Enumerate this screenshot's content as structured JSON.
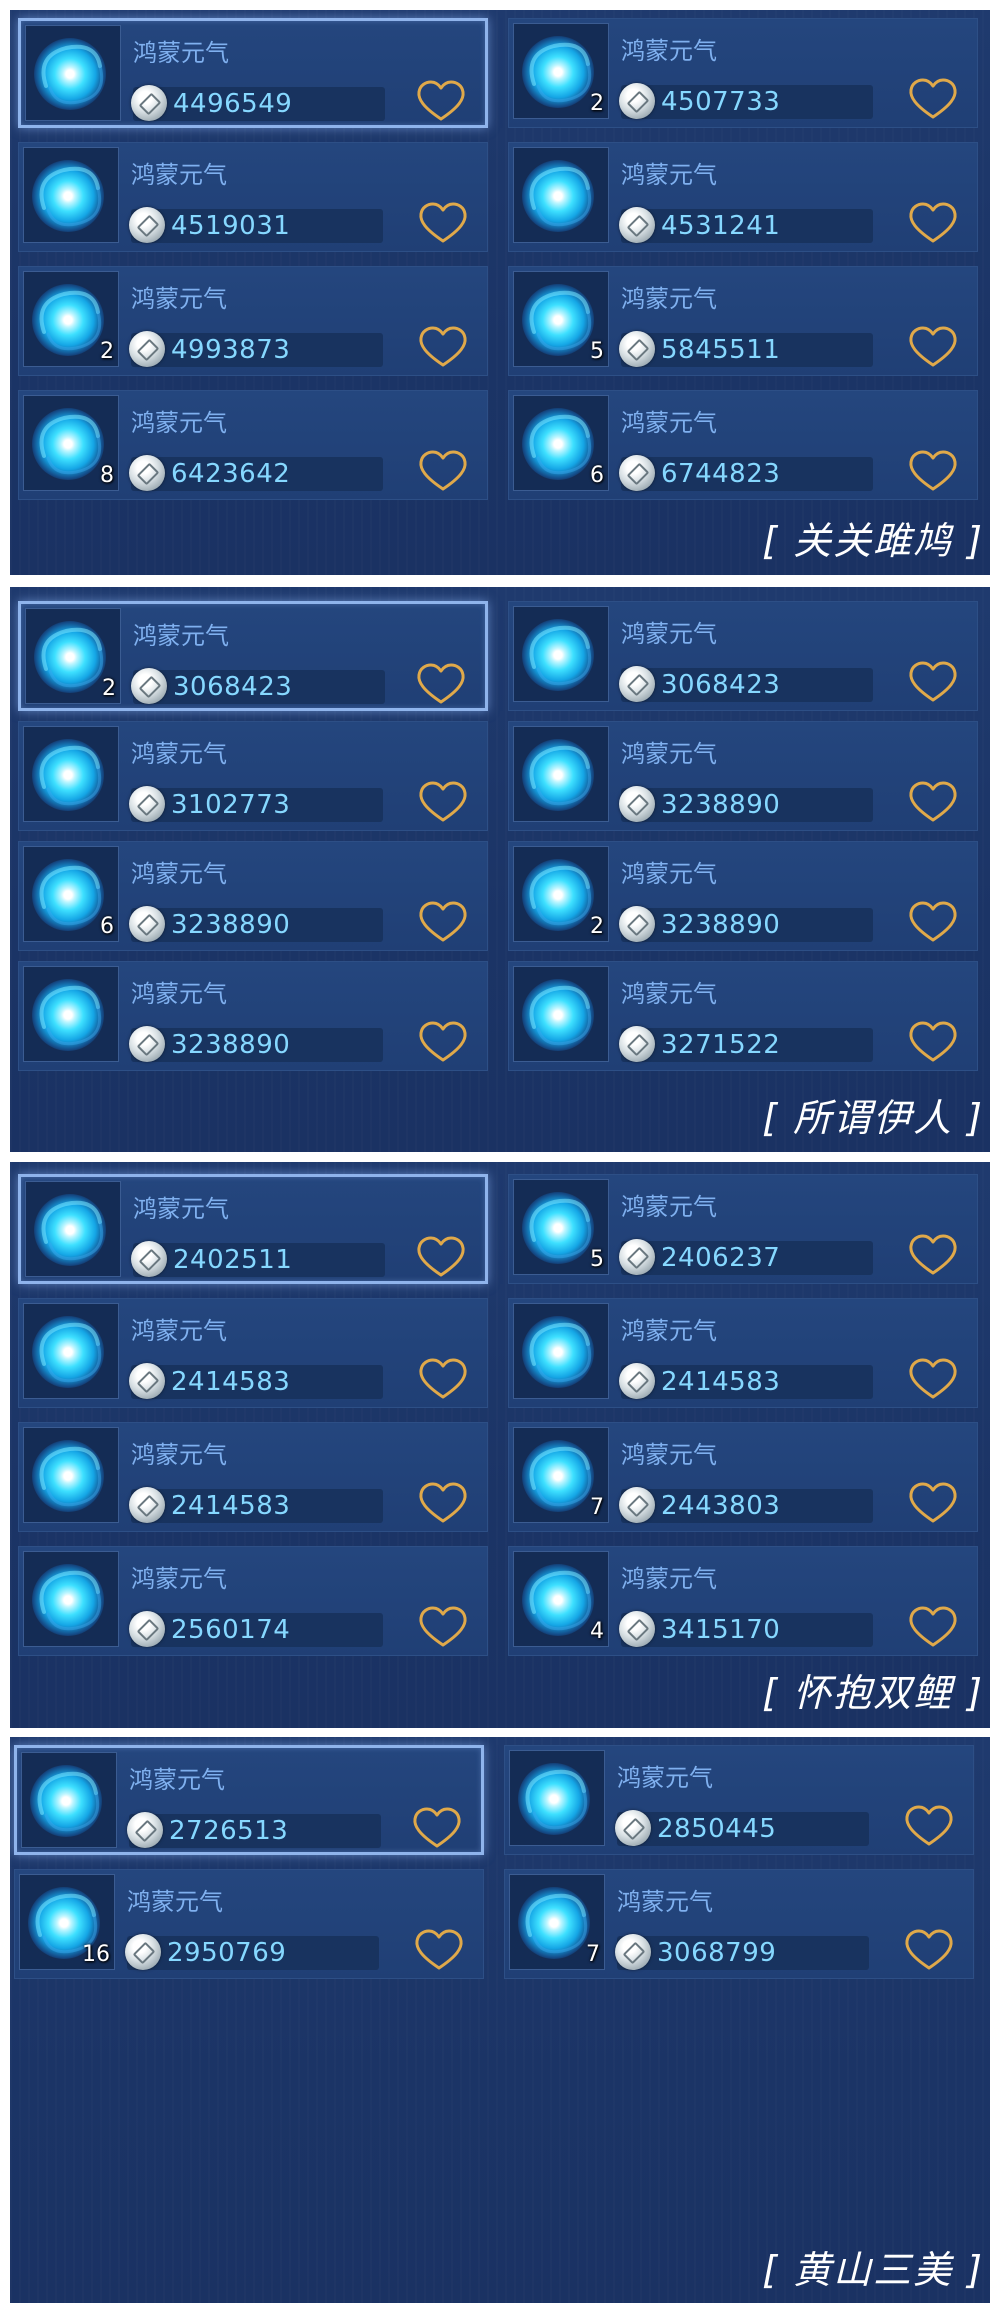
{
  "panels": [
    {
      "caption": "[ 关关雎鸠 ]",
      "items": [
        {
          "name": "鸿蒙元气",
          "price": "4496549",
          "count": "",
          "selected": true
        },
        {
          "name": "鸿蒙元气",
          "price": "4507733",
          "count": "2"
        },
        {
          "name": "鸿蒙元气",
          "price": "4519031",
          "count": ""
        },
        {
          "name": "鸿蒙元气",
          "price": "4531241",
          "count": ""
        },
        {
          "name": "鸿蒙元气",
          "price": "4993873",
          "count": "2"
        },
        {
          "name": "鸿蒙元气",
          "price": "5845511",
          "count": "5"
        },
        {
          "name": "鸿蒙元气",
          "price": "6423642",
          "count": "8"
        },
        {
          "name": "鸿蒙元气",
          "price": "6744823",
          "count": "6"
        }
      ]
    },
    {
      "caption": "[ 所谓伊人 ]",
      "items": [
        {
          "name": "鸿蒙元气",
          "price": "3068423",
          "count": "2",
          "selected": true
        },
        {
          "name": "鸿蒙元气",
          "price": "3068423",
          "count": ""
        },
        {
          "name": "鸿蒙元气",
          "price": "3102773",
          "count": ""
        },
        {
          "name": "鸿蒙元气",
          "price": "3238890",
          "count": ""
        },
        {
          "name": "鸿蒙元气",
          "price": "3238890",
          "count": "6"
        },
        {
          "name": "鸿蒙元气",
          "price": "3238890",
          "count": "2"
        },
        {
          "name": "鸿蒙元气",
          "price": "3238890",
          "count": ""
        },
        {
          "name": "鸿蒙元气",
          "price": "3271522",
          "count": ""
        }
      ]
    },
    {
      "caption": "[ 怀抱双鲤 ]",
      "items": [
        {
          "name": "鸿蒙元气",
          "price": "2402511",
          "count": "",
          "selected": true
        },
        {
          "name": "鸿蒙元气",
          "price": "2406237",
          "count": "5"
        },
        {
          "name": "鸿蒙元气",
          "price": "2414583",
          "count": ""
        },
        {
          "name": "鸿蒙元气",
          "price": "2414583",
          "count": ""
        },
        {
          "name": "鸿蒙元气",
          "price": "2414583",
          "count": ""
        },
        {
          "name": "鸿蒙元气",
          "price": "2443803",
          "count": "7"
        },
        {
          "name": "鸿蒙元气",
          "price": "2560174",
          "count": ""
        },
        {
          "name": "鸿蒙元气",
          "price": "3415170",
          "count": "4"
        }
      ]
    },
    {
      "caption": "[ 黄山三美 ]",
      "items": [
        {
          "name": "鸿蒙元气",
          "price": "2726513",
          "count": "",
          "selected": true
        },
        {
          "name": "鸿蒙元气",
          "price": "2850445",
          "count": ""
        },
        {
          "name": "鸿蒙元气",
          "price": "2950769",
          "count": "16"
        },
        {
          "name": "鸿蒙元气",
          "price": "3068799",
          "count": "7"
        }
      ]
    }
  ],
  "icons": {
    "item": "swirl-orb-icon",
    "currency": "silver-coin-icon",
    "favorite": "heart-outline-icon"
  },
  "colors": {
    "panel_bg": "#1d3769",
    "card_bg": "#22427a",
    "title_text": "#7fb0ef",
    "price_text": "#86d8ff",
    "heart": "#e0a94a",
    "selected_border": "#8fb4ec"
  }
}
